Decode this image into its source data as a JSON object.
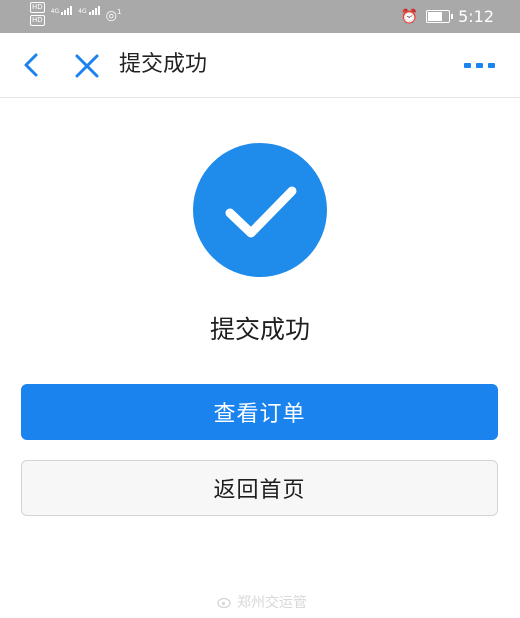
{
  "status_bar": {
    "hd_badges": [
      "HD",
      "HD"
    ],
    "network_labels": [
      "4G",
      "4G"
    ],
    "hotspot_count": "1",
    "time": "5:12",
    "battery_level": 0.8
  },
  "nav": {
    "title": "提交成功",
    "back_icon": "chevron-left-icon",
    "close_icon": "close-icon",
    "more_icon": "more-horizontal-icon"
  },
  "result": {
    "icon": "check-circle-icon",
    "message": "提交成功"
  },
  "buttons": {
    "view_order": "查看订单",
    "back_home": "返回首页"
  },
  "watermark": {
    "text": "郑州交运管"
  },
  "colors": {
    "accent": "#1a83ee",
    "success_circle": "#1f8ceb",
    "status_bar": "#a9a9a9",
    "nav_icons": "#1a83ee"
  }
}
